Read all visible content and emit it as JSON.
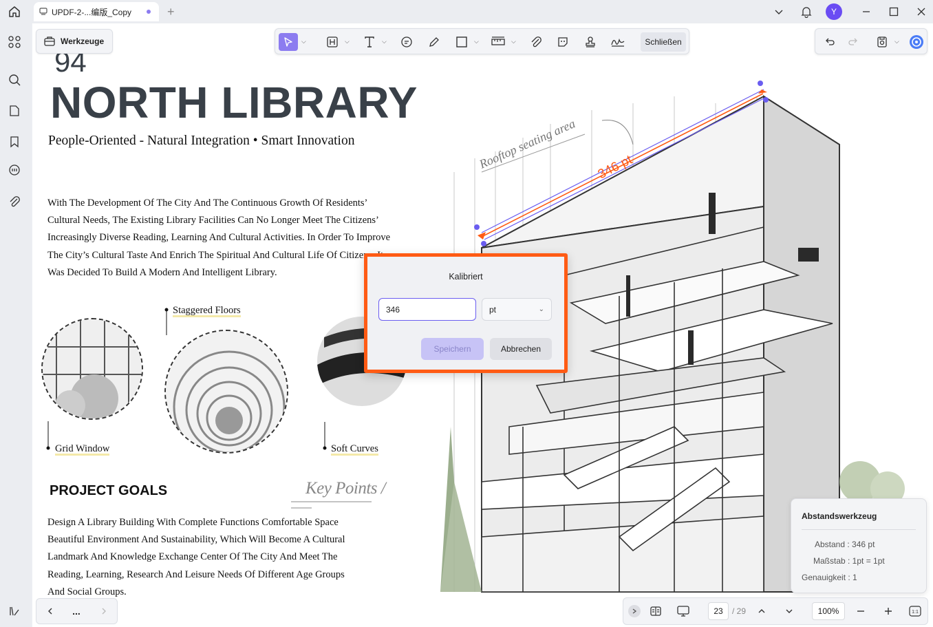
{
  "titlebar": {
    "tab_title": "UPDF-2-...编版_Copy"
  },
  "user": {
    "avatar_letter": "Y"
  },
  "toolbar": {
    "tools_label": "Werkzeuge",
    "close_label": "Schließen"
  },
  "document": {
    "page_number": "94",
    "title": "NORTH LIBRARY",
    "subtitle": "People-Oriented - Natural Integration • Smart Innovation",
    "intro_lines": [
      "With The Development Of The City And The Continuous Growth Of Residents’",
      "Cultural Needs, The Existing Library Facilities Can No Longer Meet The Citizens’",
      "Increasingly Diverse Reading, Learning And Cultural Activities. In Order To Improve",
      "The City’s Cultural Taste And Enrich The Spiritual And Cultural Life Of Citizens, It",
      "Was Decided To Build A Modern And Intelligent Library."
    ],
    "captions": {
      "staggered": "Staggered Floors",
      "grid": "Grid Window",
      "curves": "Soft Curves"
    },
    "goals_heading": "PROJECT GOALS",
    "key_points": "Key Points /",
    "goals_lines": [
      "Design A Library Building With Complete Functions Comfortable Space",
      "Beautiful Environment And Sustainability, Which Will Become A Cultural",
      "Landmark And Knowledge Exchange Center Of The City And Meet The",
      "Reading, Learning, Research And Leisure Needs Of Different Age Groups",
      "And Social Groups."
    ],
    "annotation_text": "Rooftop seating area",
    "measure_label": "346 pt"
  },
  "dialog": {
    "title": "Kalibriert",
    "input_value": "346",
    "unit": "pt",
    "save_label": "Speichern",
    "cancel_label": "Abbrechen"
  },
  "distance_panel": {
    "title": "Abstandswerkzeug",
    "distance": "Abstand : 346 pt",
    "scale": "Maßstab : 1pt = 1pt",
    "precision": "Genauigkeit : 1"
  },
  "pagination": {
    "current": "23",
    "total": "/ 29",
    "zoom": "100%",
    "more": "..."
  },
  "colors": {
    "accent": "#8c7cf0",
    "dialog_border": "#ff5b14",
    "measure_line": "#ff5b14",
    "save_disabled": "#c7c3f6"
  }
}
